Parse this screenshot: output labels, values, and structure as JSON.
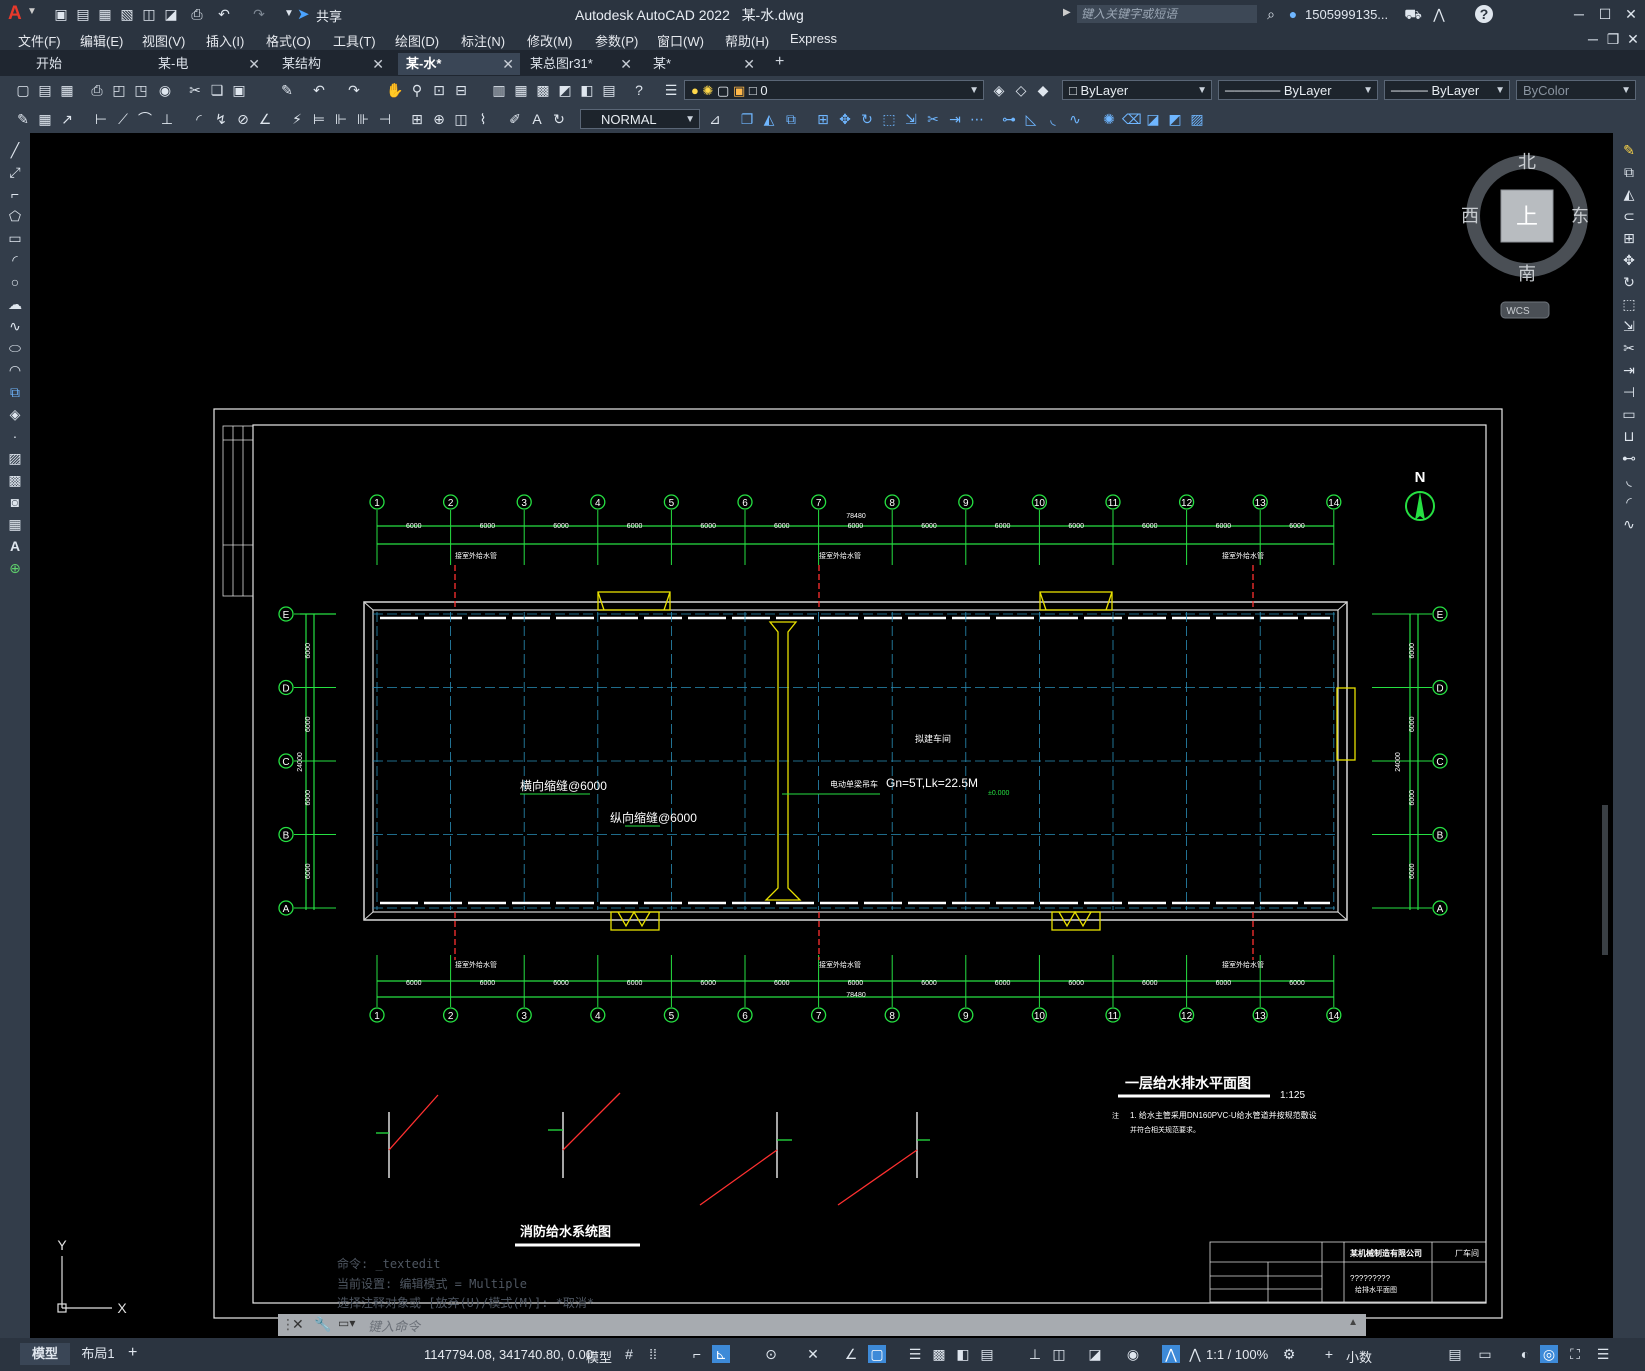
{
  "app": {
    "title": "Autodesk AutoCAD 2022",
    "filename": "某-水.dwg",
    "share_label": "共享",
    "search_placeholder": "键入关键字或短语",
    "user": "1505999135...",
    "logo": "A"
  },
  "menu": [
    "文件(F)",
    "编辑(E)",
    "视图(V)",
    "插入(I)",
    "格式(O)",
    "工具(T)",
    "绘图(D)",
    "标注(N)",
    "修改(M)",
    "参数(P)",
    "窗口(W)",
    "帮助(H)",
    "Express"
  ],
  "tabs": [
    {
      "label": "开始",
      "active": false
    },
    {
      "label": "某-电",
      "active": false
    },
    {
      "label": "某结构",
      "active": false
    },
    {
      "label": "某-水*",
      "active": true
    },
    {
      "label": "某总图r31*",
      "active": false
    },
    {
      "label": "某*",
      "active": false
    }
  ],
  "toolbar": {
    "layer_value": "0",
    "color_value": "ByLayer",
    "linetype_value": "ByLayer",
    "lineweight_value": "ByLayer",
    "plotstyle_value": "ByColor",
    "dimstyle_value": "NORMAL"
  },
  "viewcube": {
    "north": "北",
    "south": "南",
    "east": "东",
    "west": "西",
    "top": "上",
    "wcs": "WCS"
  },
  "drawing": {
    "north_arrow": "N",
    "grid_numbers": [
      "1",
      "2",
      "3",
      "4",
      "5",
      "6",
      "7",
      "8",
      "9",
      "10",
      "11",
      "12",
      "13",
      "14"
    ],
    "grid_letters": [
      "E",
      "D",
      "C",
      "B",
      "A"
    ],
    "bay_dim": "6000",
    "total_dim": "78480",
    "width_dim": "24000",
    "labels": {
      "crane": "Gn=5T,Lk=22.5M",
      "crane_prefix": "电动单梁吊车",
      "joint_h": "横向缩缝@6000",
      "joint_v": "纵向缩缝@6000",
      "room": "拟建车间",
      "elev": "±0.000",
      "downpipe": "接室外给水管"
    },
    "plan_title": "一层给水排水平面图",
    "plan_scale": "1:125",
    "note_prefix": "注",
    "note_line1": "1. 给水主管采用DN160PVC-U给水管道并按规范敷设",
    "note_line2": "   并符合相关规范要求。",
    "system_title": "消防给水系统图",
    "company": "某机械制造有限公司",
    "project": "厂车间",
    "drawing_code": "?????????",
    "drawing_name": "给排水平面图"
  },
  "command": {
    "history": [
      "命令: _textedit",
      "当前设置: 编辑模式 = Multiple",
      "选择注释对象或 [放弃(U)/模式(M)]: *取消*"
    ],
    "prompt": "键入命令"
  },
  "ucs": {
    "x": "X",
    "y": "Y"
  },
  "status": {
    "layout_tabs": [
      "模型",
      "布局1"
    ],
    "coords": "1147794.08, 341740.80, 0.00",
    "space": "模型",
    "scale": "1:1 / 100%",
    "units": "小数"
  }
}
